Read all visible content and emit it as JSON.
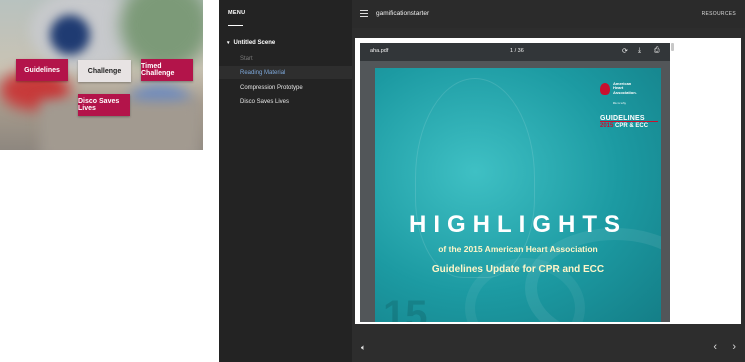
{
  "thumbnail": {
    "buttons": [
      {
        "label": "Guidelines",
        "style": "accent"
      },
      {
        "label": "Challenge",
        "style": "light"
      },
      {
        "label": "Timed Challenge",
        "style": "accent"
      },
      {
        "label": "Disco Saves Lives",
        "style": "accent"
      }
    ],
    "accent_color": "#b3144a"
  },
  "sidebar": {
    "title": "MENU",
    "scene": {
      "label": "Untitled Scene",
      "icon": "caret-down-icon"
    },
    "items": [
      {
        "label": "Start",
        "state": "muted"
      },
      {
        "label": "Reading Material",
        "state": "active"
      },
      {
        "label": "Compression Prototype",
        "state": "normal"
      },
      {
        "label": "Disco Saves Lives",
        "state": "normal"
      }
    ],
    "active_color": "#7da7d9"
  },
  "topbar": {
    "menu_icon": "hamburger-icon",
    "title": "gamificationstarter",
    "resources_label": "RESOURCES"
  },
  "pdf_viewer": {
    "file_name": "aha.pdf",
    "page_indicator": "1 / 36",
    "icons": [
      "rotate-icon",
      "download-icon",
      "print-icon"
    ],
    "zoom_icon": "zoom-icon",
    "cover": {
      "org_name_line1": "American",
      "org_name_line2": "Heart",
      "org_name_line3": "Association.",
      "tagline": "life is why",
      "badge_line1": "GUIDELINES",
      "badge_year": "2015",
      "badge_line2": "CPR & ECC",
      "headline": "HIGHLIGHTS",
      "subheadline": "of the 2015 American Heart Association",
      "subheadline2": "Guidelines Update for CPR and ECC",
      "background_color": "#1c9aa2"
    }
  },
  "bottombar": {
    "volume_icon": "volume-icon",
    "prev_icon": "chevron-left-icon",
    "next_icon": "chevron-right-icon"
  }
}
